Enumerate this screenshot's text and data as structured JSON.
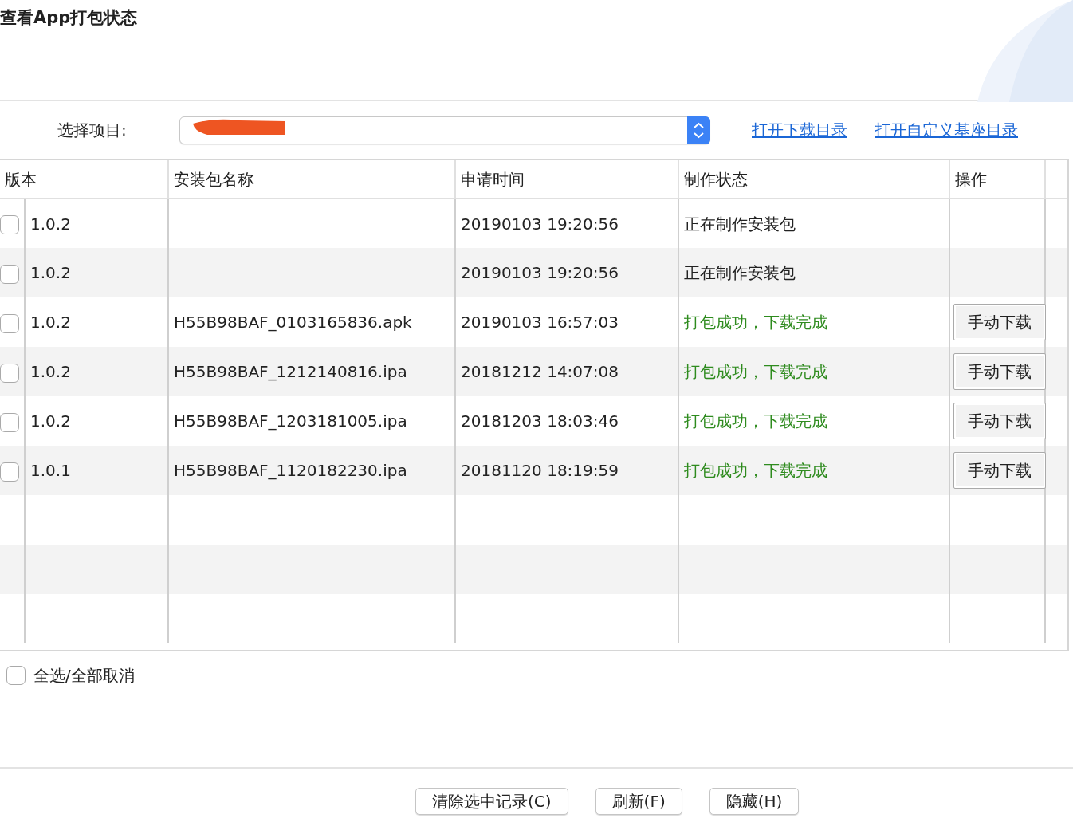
{
  "window": {
    "title": "查看App打包状态"
  },
  "project": {
    "label": "选择项目:"
  },
  "links": [
    "打开下载目录",
    "打开自定义基座目录"
  ],
  "table": {
    "columns": [
      "版本",
      "安装包名称",
      "申请时间",
      "制作状态",
      "操作"
    ],
    "rows": [
      {
        "checked": false,
        "version": "1.0.2",
        "package": "",
        "time": "20190103 19:20:56",
        "status": "正在制作安装包",
        "kind": "in_progress"
      },
      {
        "checked": false,
        "version": "1.0.2",
        "package": "",
        "time": "20190103 19:20:56",
        "status": "正在制作安装包",
        "kind": "in_progress"
      },
      {
        "checked": false,
        "version": "1.0.2",
        "package": "H55B98BAF_0103165836.apk",
        "time": "20190103 16:57:03",
        "status": "打包成功，下载完成",
        "kind": "success",
        "action": "手动下载"
      },
      {
        "checked": false,
        "version": "1.0.2",
        "package": "H55B98BAF_1212140816.ipa",
        "time": "20181212 14:07:08",
        "status": "打包成功，下载完成",
        "kind": "success",
        "action": "手动下载"
      },
      {
        "checked": false,
        "version": "1.0.2",
        "package": "H55B98BAF_1203181005.ipa",
        "time": "20181203 18:03:46",
        "status": "打包成功，下载完成",
        "kind": "success",
        "action": "手动下载"
      },
      {
        "checked": false,
        "version": "1.0.1",
        "package": "H55B98BAF_1120182230.ipa",
        "time": "20181120 18:19:59",
        "status": "打包成功，下载完成",
        "kind": "success",
        "action": "手动下载"
      }
    ]
  },
  "select_all": {
    "label": "全选/全部取消",
    "checked": false
  },
  "buttons": [
    "清除选中记录(C)",
    "刷新(F)",
    "隐藏(H)"
  ]
}
